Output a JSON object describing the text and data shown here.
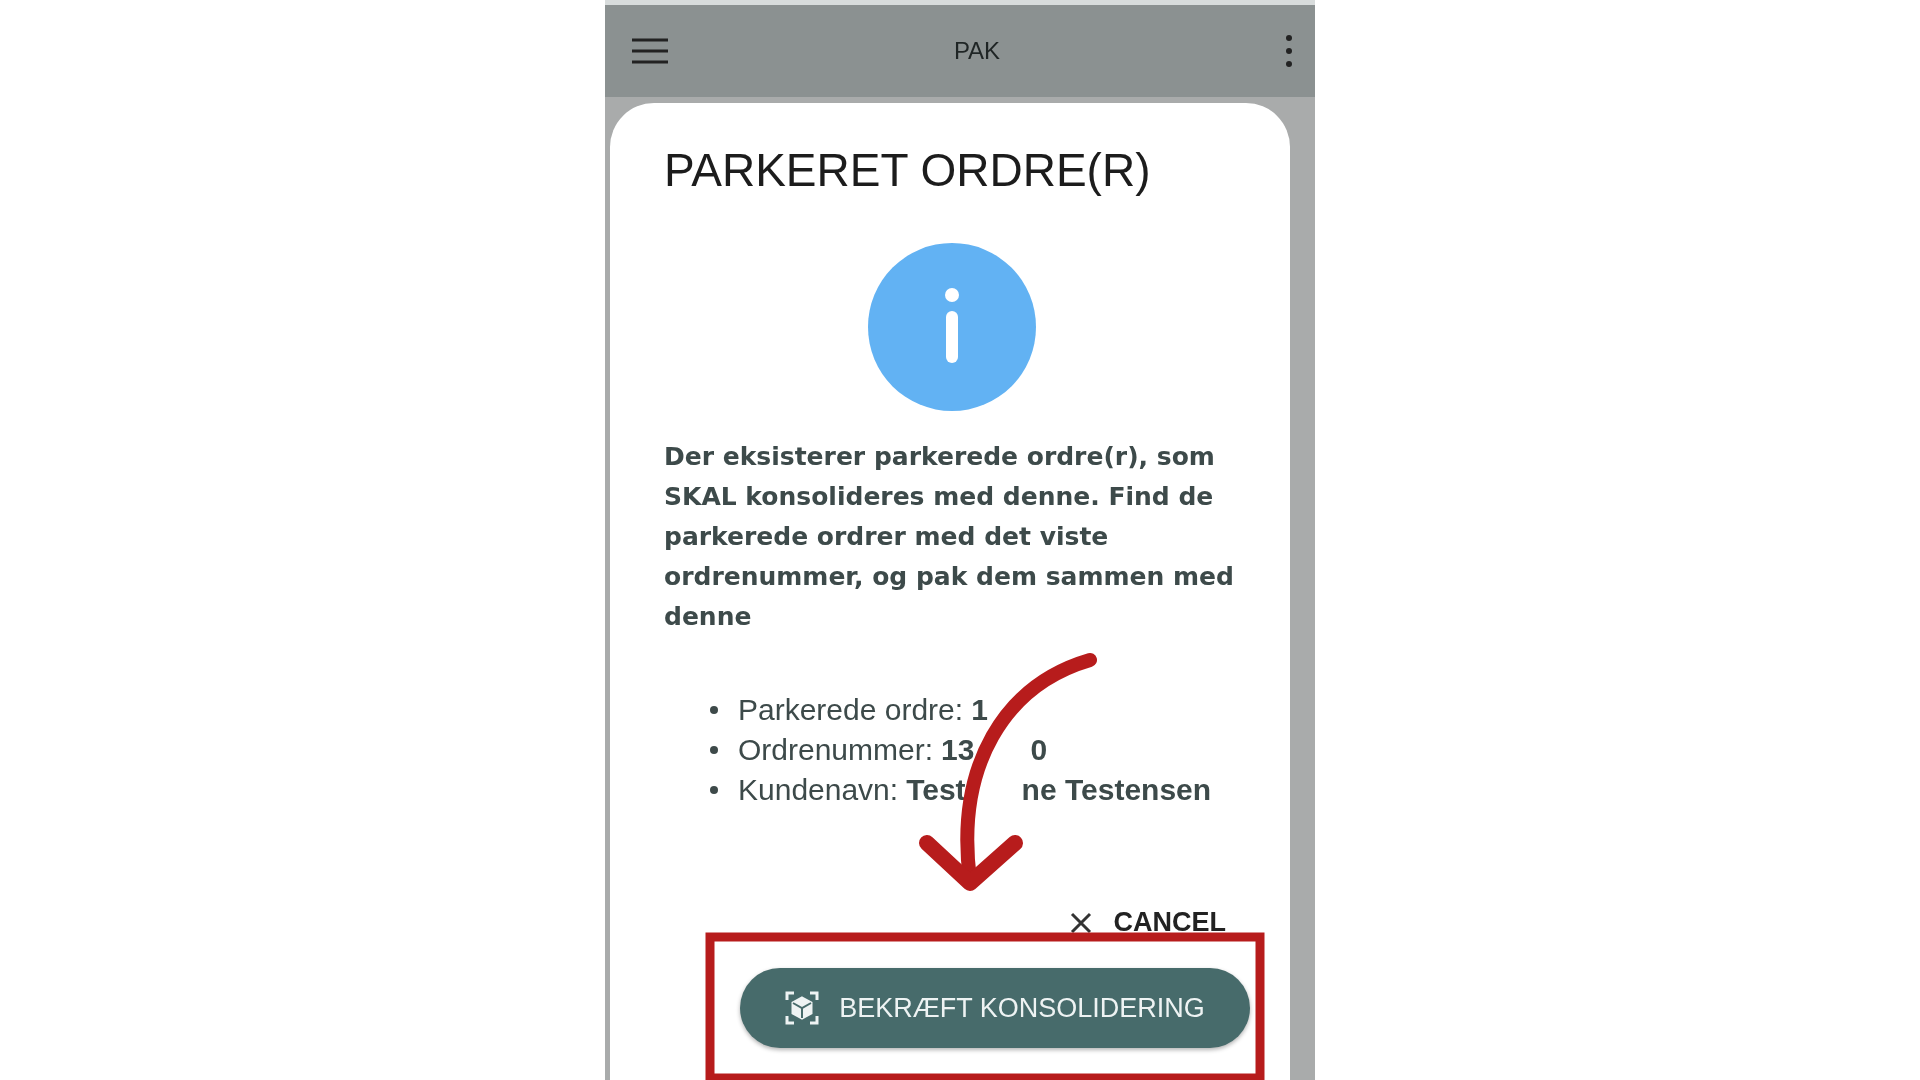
{
  "app_bar": {
    "title": "PAK"
  },
  "dialog": {
    "title": "PARKERET ORDRE(R)",
    "message": "Der eksisterer parkerede ordre(r), som SKAL konsolideres med denne. Find de parkerede ordrer med det viste ordrenummer, og pak dem sammen med denne",
    "details": [
      {
        "label": "Parkerede ordre:",
        "value_parts": [
          "1"
        ]
      },
      {
        "label": "Ordrenummer:",
        "value_parts": [
          "13",
          "0"
        ]
      },
      {
        "label": "Kundenavn:",
        "value_parts": [
          "Test",
          "ne Testensen"
        ]
      }
    ],
    "cancel": "CANCEL",
    "confirm": "BEKRÆFT KONSOLIDERING"
  }
}
